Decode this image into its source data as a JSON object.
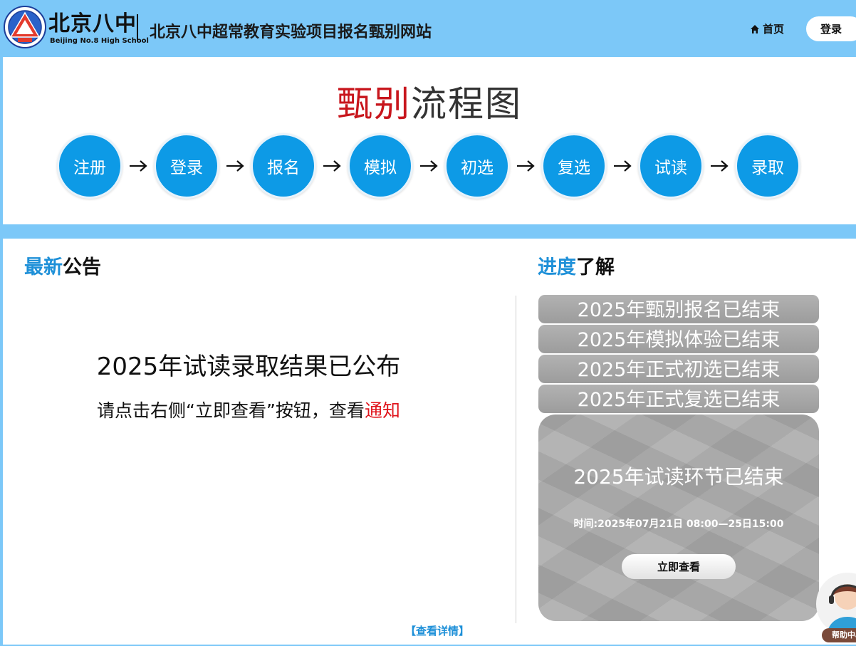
{
  "header": {
    "logo_cn": "北京八中",
    "logo_en": "Beijing No.8 High School",
    "site_title": "北京八中超常教育实验项目报名甄别网站",
    "nav_home": "首页",
    "nav_login": "登录"
  },
  "flow": {
    "title_red": "甄别",
    "title_rest": "流程图",
    "steps": [
      "注册",
      "登录",
      "报名",
      "模拟",
      "初选",
      "复选",
      "试读",
      "录取"
    ]
  },
  "notice": {
    "title_blue": "最新",
    "title_black": "公告",
    "headline": "2025年试读录取结果已公布",
    "sub_text": "请点击右侧“立即查看”按钮，查看",
    "sub_link": "通知",
    "detail_link": "【查看详情】"
  },
  "progress": {
    "title_blue": "进度",
    "title_black": "了解",
    "items": [
      "2025年甄别报名已结束",
      "2025年模拟体验已结束",
      "2025年正式初选已结束",
      "2025年正式复选已结束"
    ],
    "current_title": "2025年试读环节已结束",
    "current_time": "时间:2025年07月21日 08:00—25日15:00",
    "current_button": "立即查看"
  },
  "help": {
    "label": "帮助中心"
  },
  "colors": {
    "header_bg": "#7cc8f8",
    "step_blue": "#0d9ae6",
    "accent_red": "#c8161d",
    "title_blue": "#1e90d8"
  }
}
